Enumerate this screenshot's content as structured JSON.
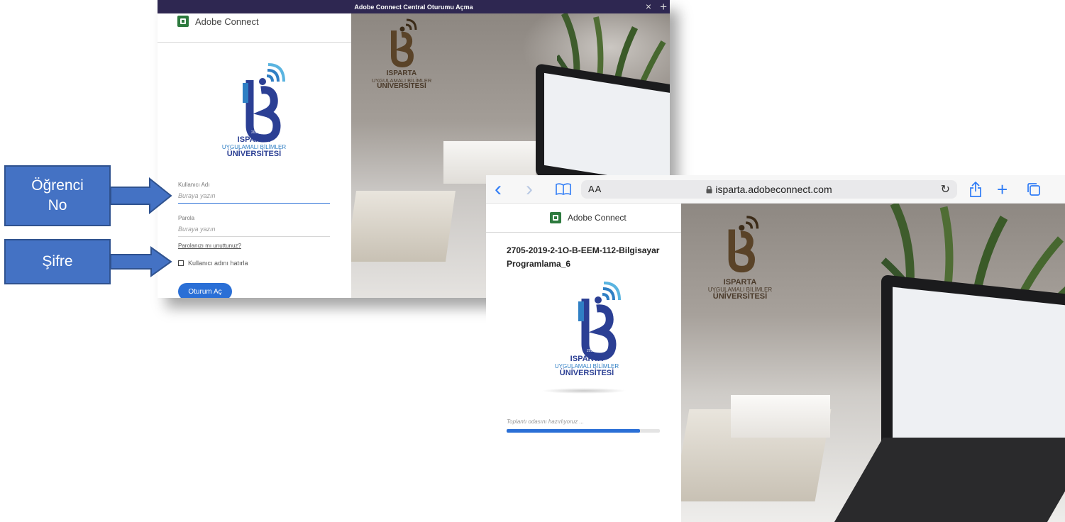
{
  "annotations": {
    "student_no_label": "Öğrenci\nNo",
    "password_label": "Şifre"
  },
  "window1": {
    "title": "Adobe Connect Central Oturumu Açma",
    "close_glyph": "×",
    "plus_glyph": "+",
    "brand": "Adobe Connect",
    "university": {
      "line1": "ISPARTA",
      "line2": "UYGULAMALI BİLİMLER",
      "line3": "ÜNİVERSİTESİ",
      "year": "2018"
    },
    "username": {
      "label": "Kullanıcı Adı",
      "placeholder": "Buraya yazın"
    },
    "password": {
      "label": "Parola",
      "placeholder": "Buraya yazın"
    },
    "forgot_link": "Parolanızı mı unuttunuz?",
    "remember_label": "Kullanıcı adını hatırla",
    "login_button": "Oturum Aç",
    "photo_logo": {
      "line1": "ISPARTA",
      "line2": "UYGULAMALI BİLİMLER",
      "line3": "ÜNİVERSİTESİ"
    }
  },
  "window2": {
    "toolbar": {
      "back_glyph": "‹",
      "forward_glyph": "›",
      "text_size": "AA",
      "url": "isparta.adobeconnect.com",
      "lock_glyph": "🔒",
      "reload_glyph": "↻",
      "share_glyph": "⇪",
      "plus_glyph": "+",
      "tabs_glyph": "⧉",
      "bookmarks_glyph": "📖"
    },
    "brand": "Adobe Connect",
    "meeting_name": "2705-2019-2-1O-B-EEM-112-Bilgisayar Programlama_6",
    "university": {
      "line1": "ISPARTA",
      "line2": "UYGULAMALI BİLİMLER",
      "line3": "ÜNİVERSİTESİ",
      "year": "2018"
    },
    "status_text": "Toplantı odasını hazırlıyoruz ...",
    "progress": 0.87,
    "photo_logo": {
      "line1": "ISPARTA",
      "line2": "UYGULAMALI BİLİMLER",
      "line3": "ÜNİVERSİTESİ"
    }
  },
  "colors": {
    "title_bar": "#2e2751",
    "accent_blue": "#2a6fd6",
    "callout_fill": "#4472c4",
    "callout_border": "#2f528f",
    "uni_dark_blue": "#2b3f94",
    "uni_light_blue": "#2f7fc4",
    "photo_logo_brown": "#5a4328"
  }
}
